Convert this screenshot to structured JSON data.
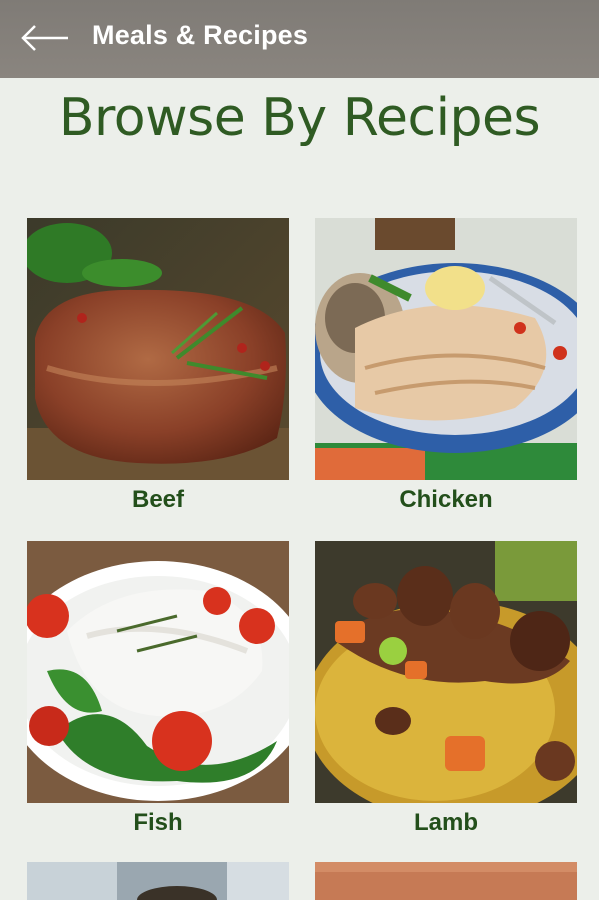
{
  "appbar": {
    "back_icon": "arrow-left-icon",
    "title": "Meals & Recipes"
  },
  "heading": "Browse By Recipes",
  "categories": [
    {
      "label": "Beef",
      "image": "grilled-steak-photo"
    },
    {
      "label": "Chicken",
      "image": "sliced-chicken-plate-photo"
    },
    {
      "label": "Fish",
      "image": "fish-fillet-salad-photo"
    },
    {
      "label": "Lamb",
      "image": "lamb-rice-pilaf-photo"
    },
    {
      "label": "",
      "image": "partial-dish-photo"
    },
    {
      "label": "",
      "image": "partial-dish-photo-2"
    }
  ],
  "colors": {
    "appbar": "#85817b",
    "background": "#ecefea",
    "heading": "#2f5b23",
    "label": "#234f1b"
  }
}
